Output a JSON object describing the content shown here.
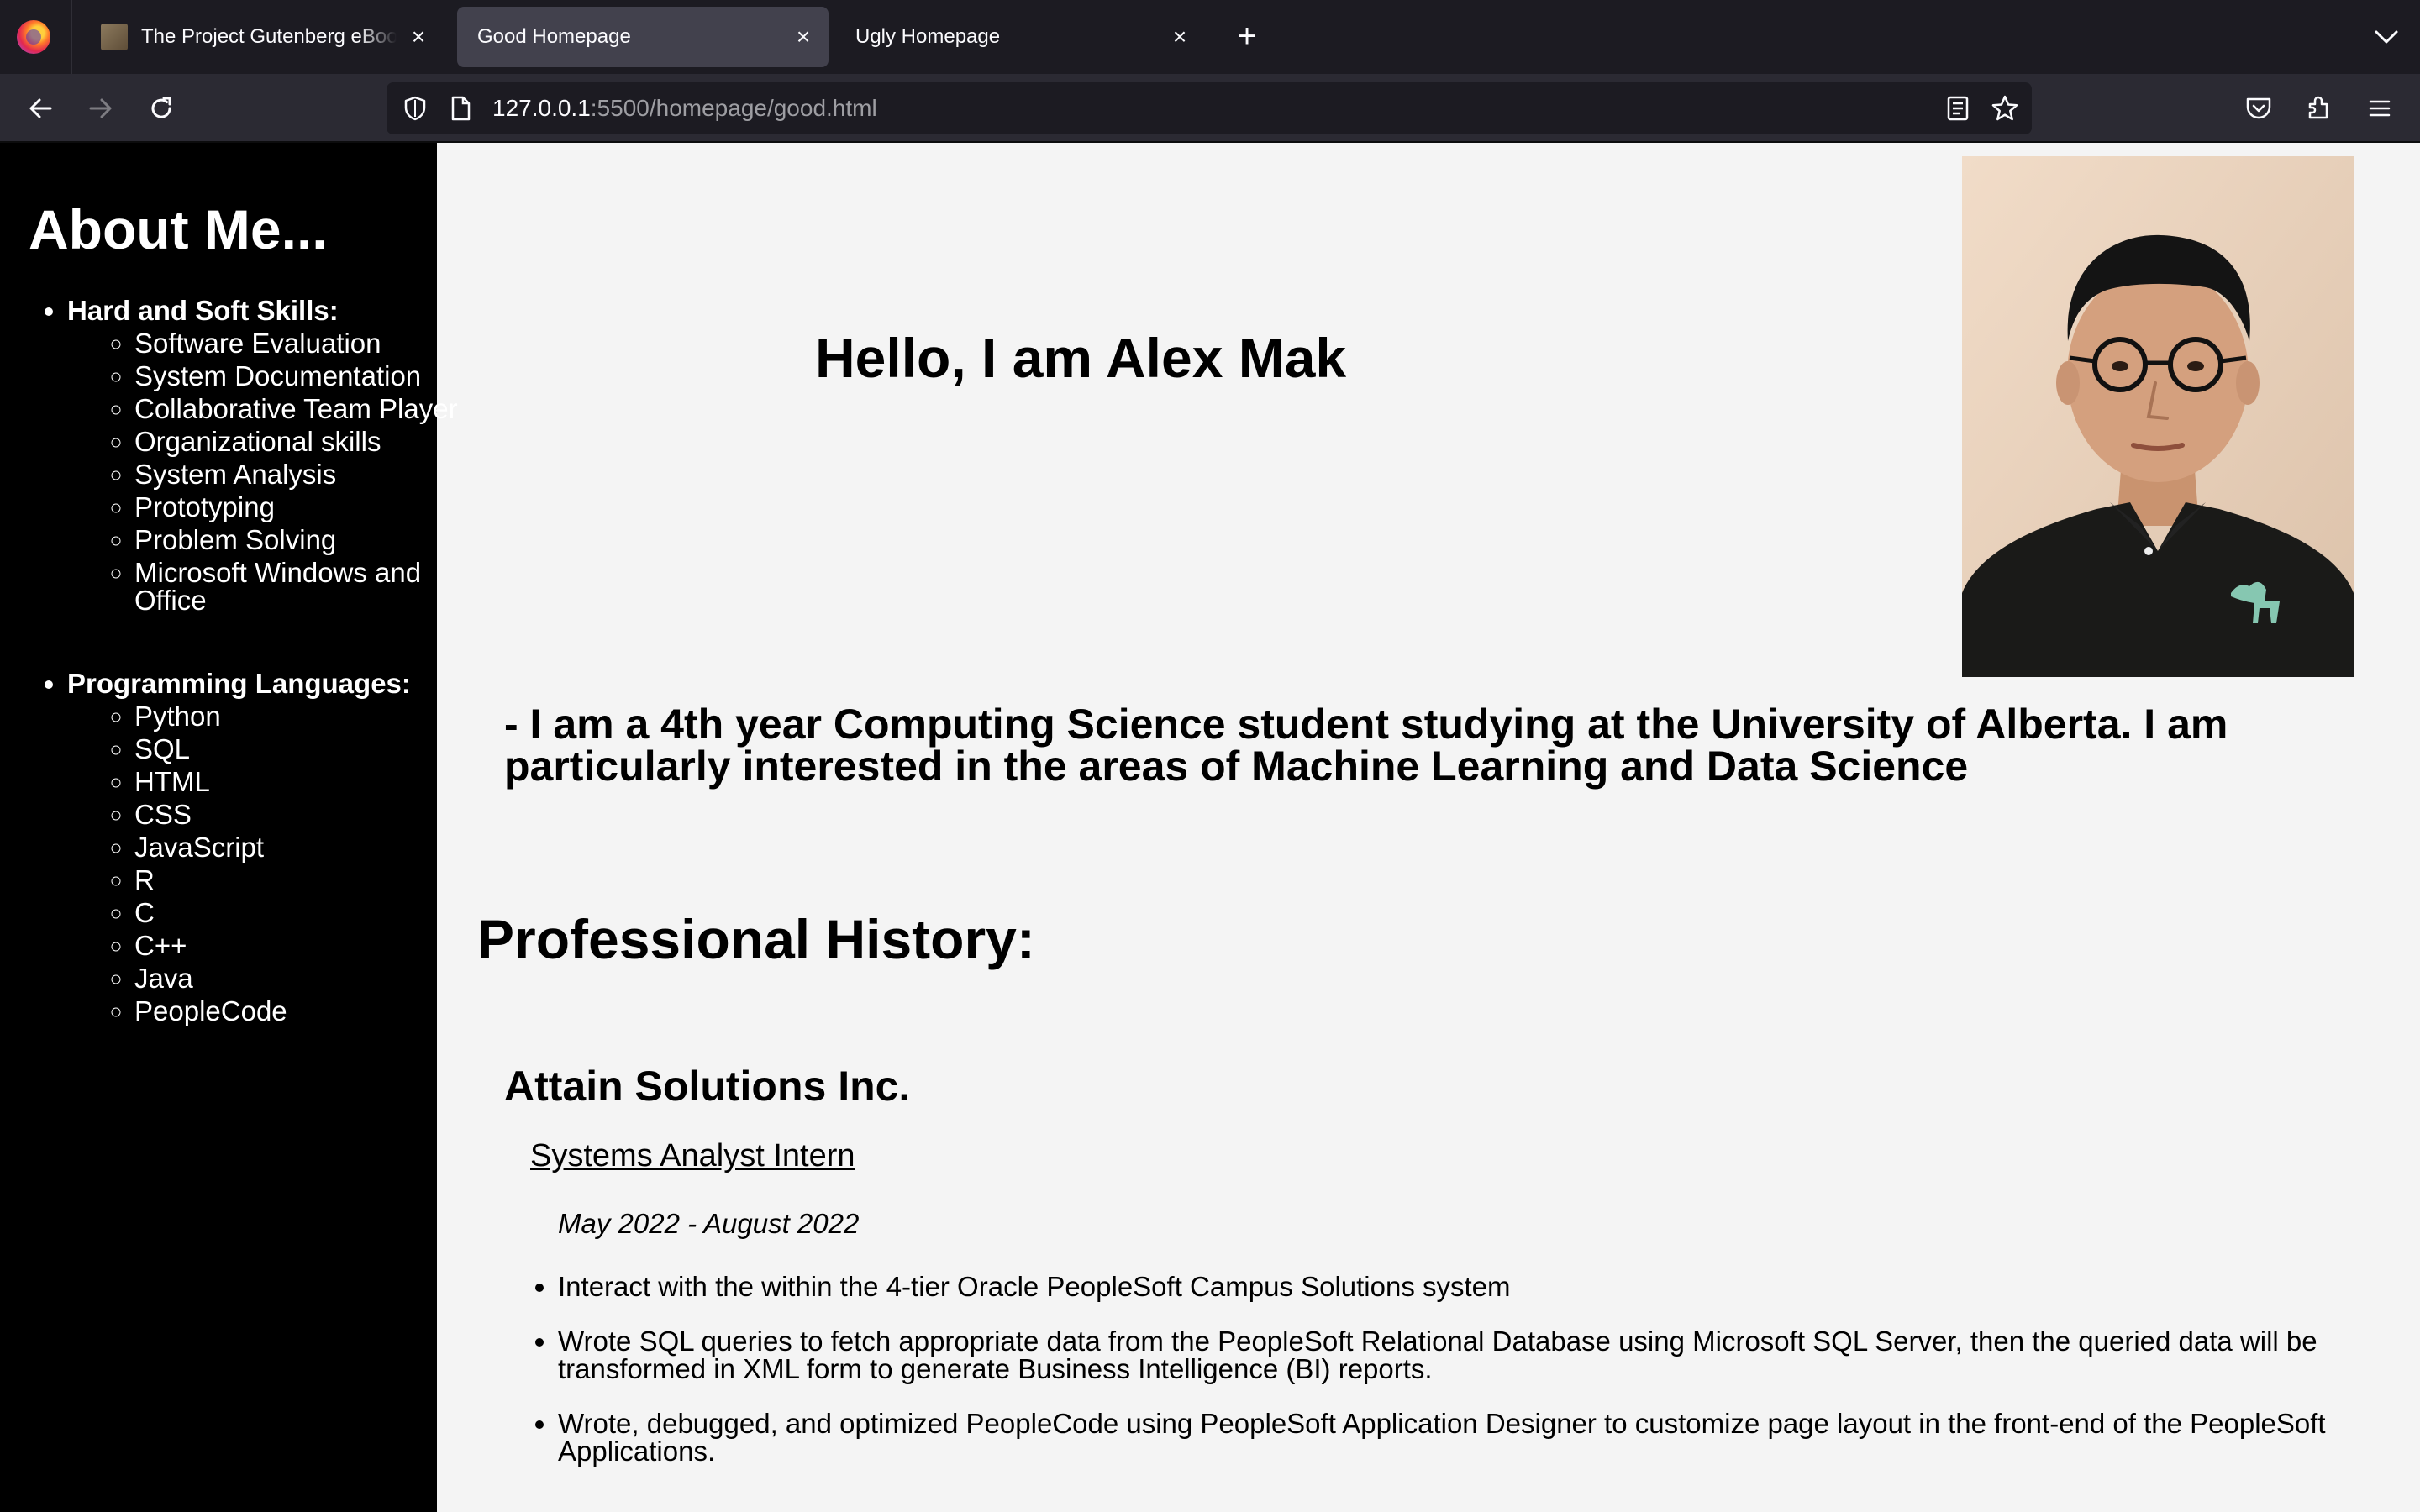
{
  "browser": {
    "tabs": [
      {
        "title": "The Project Gutenberg eBook of",
        "active": false
      },
      {
        "title": "Good Homepage",
        "active": true
      },
      {
        "title": "Ugly Homepage",
        "active": false
      }
    ],
    "url_host": "127.0.0.1",
    "url_path": ":5500/homepage/good.html"
  },
  "sidebar": {
    "title": "About Me...",
    "skills_heading": "Hard and Soft Skills:",
    "skills": [
      "Software Evaluation",
      "System Documentation",
      "Collaborative Team Player",
      "Organizational skills",
      "System Analysis",
      "Prototyping",
      "Problem Solving",
      "Microsoft Windows and Office"
    ],
    "languages_heading": "Programming Languages:",
    "languages": [
      "Python",
      "SQL",
      "HTML",
      "CSS",
      "JavaScript",
      "R",
      "C",
      "C++",
      "Java",
      "PeopleCode"
    ]
  },
  "main": {
    "greeting": "Hello, I am Alex Mak",
    "intro": "- I am a 4th year Computing Science student studying at the University of Alberta. I am particularly interested in the areas of Machine Learning and Data Science",
    "section_title": "Professional History:",
    "company": "Attain Solutions Inc.",
    "role": "Systems Analyst Intern",
    "dates": "May 2022 - August 2022",
    "duties": [
      "Interact with the within the 4-tier Oracle PeopleSoft Campus Solutions system",
      "Wrote SQL queries to fetch appropriate data from the PeopleSoft Relational Database using Microsoft SQL Server, then the queried data will be transformed in XML form to generate Business Intelligence (BI) reports.",
      "Wrote, debugged, and optimized PeopleCode using PeopleSoft Application Designer to customize page layout in the front-end of the PeopleSoft Applications."
    ]
  },
  "colors": {
    "sidebar_bg": "#000000",
    "page_bg": "#f4f4f4",
    "chrome_bg": "#1c1b22",
    "toolbar_bg": "#2b2a33",
    "active_tab_bg": "#42414d"
  }
}
